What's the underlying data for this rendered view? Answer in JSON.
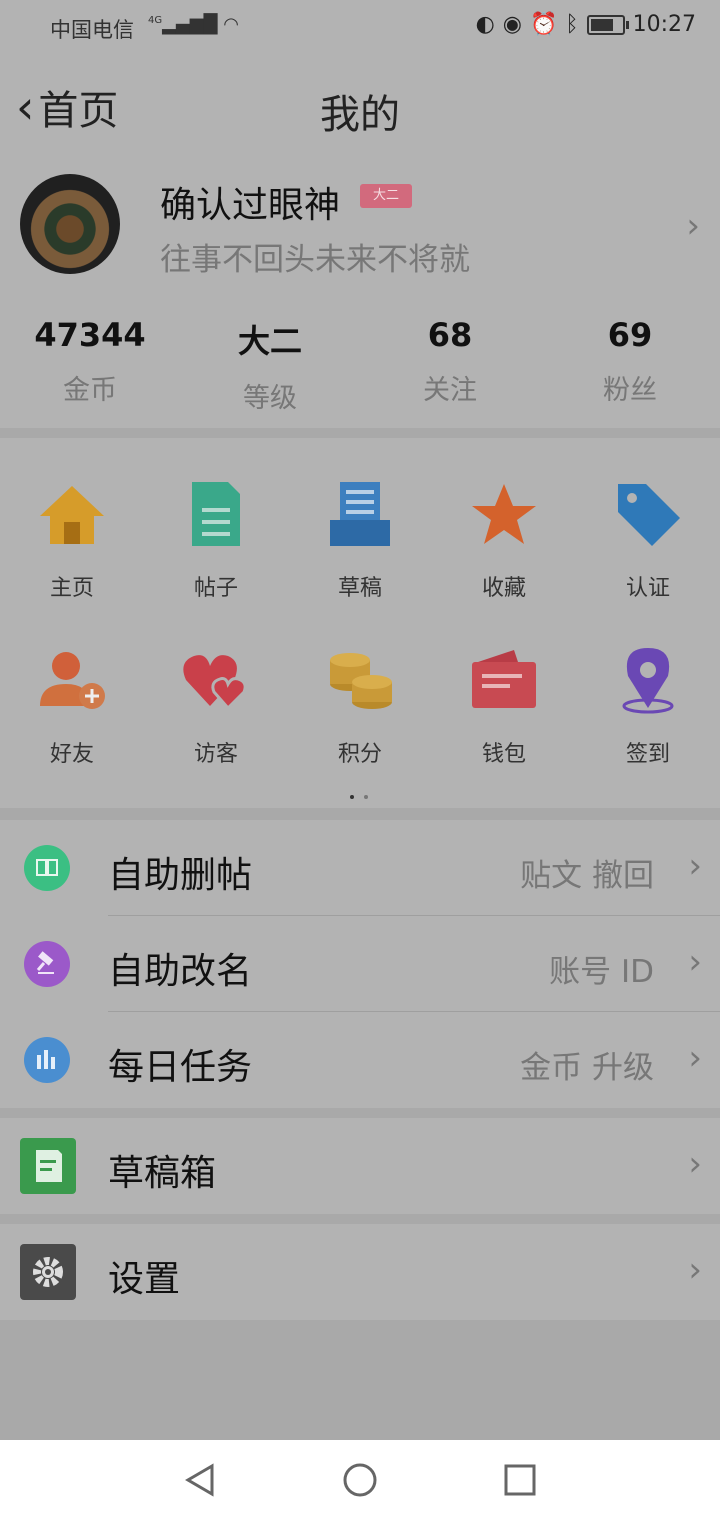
{
  "status_bar": {
    "carrier": "中国电信",
    "network_badge": "4G",
    "time": "10:27",
    "battery_level": 0.75
  },
  "header": {
    "back_label": "首页",
    "title": "我的"
  },
  "profile": {
    "username": "确认过眼神",
    "level_badge": "大二",
    "signature": "往事不回头未来不将就"
  },
  "stats": [
    {
      "value": "47344",
      "label": "金币"
    },
    {
      "value": "大二",
      "label": "等级"
    },
    {
      "value": "68",
      "label": "关注"
    },
    {
      "value": "69",
      "label": "粉丝"
    }
  ],
  "grid": [
    {
      "label": "主页",
      "icon": "home-icon"
    },
    {
      "label": "帖子",
      "icon": "post-icon"
    },
    {
      "label": "草稿",
      "icon": "draft-icon"
    },
    {
      "label": "收藏",
      "icon": "star-icon"
    },
    {
      "label": "认证",
      "icon": "tag-icon"
    },
    {
      "label": "好友",
      "icon": "add-friend-icon"
    },
    {
      "label": "访客",
      "icon": "hearts-icon"
    },
    {
      "label": "积分",
      "icon": "coins-icon"
    },
    {
      "label": "钱包",
      "icon": "wallet-icon"
    },
    {
      "label": "签到",
      "icon": "location-pin-icon"
    }
  ],
  "list_group_1": [
    {
      "label": "自助删帖",
      "hint": "贴文  撤回",
      "icon": "book-icon",
      "color": "#3bbf83"
    },
    {
      "label": "自助改名",
      "hint": "账号  ID",
      "icon": "gavel-icon",
      "color": "#9b59c9"
    },
    {
      "label": "每日任务",
      "hint": "金币  升级",
      "icon": "bar-chart-icon",
      "color": "#4a8ed0"
    }
  ],
  "list_group_2": [
    {
      "label": "草稿箱",
      "icon": "draft-box-icon",
      "color": "#3a9a4d"
    }
  ],
  "list_group_3": [
    {
      "label": "设置",
      "icon": "gear-icon",
      "color": "#4a4a4a"
    }
  ]
}
